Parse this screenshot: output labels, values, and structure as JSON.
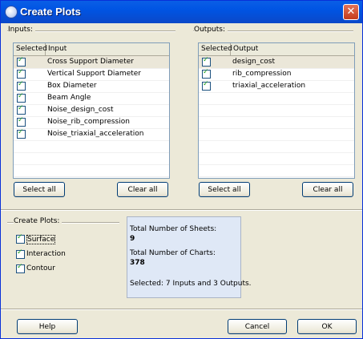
{
  "window": {
    "title": "Create Plots",
    "close_label": "✕"
  },
  "inputs": {
    "group_label": "Inputs:",
    "columns": [
      "Selected",
      "Input"
    ],
    "rows": [
      {
        "label": "Cross Support Diameter",
        "checked": true
      },
      {
        "label": "Vertical Support Diameter",
        "checked": true
      },
      {
        "label": "Box Diameter",
        "checked": true
      },
      {
        "label": "Beam Angle",
        "checked": true
      },
      {
        "label": "Noise_design_cost",
        "checked": true
      },
      {
        "label": "Noise_rib_compression",
        "checked": true
      },
      {
        "label": "Noise_triaxial_acceleration",
        "checked": true
      }
    ],
    "select_all_label": "Select all",
    "clear_all_label": "Clear all"
  },
  "outputs": {
    "group_label": "Outputs:",
    "columns": [
      "Selected",
      "Output"
    ],
    "rows": [
      {
        "label": "design_cost",
        "checked": true
      },
      {
        "label": "rib_compression",
        "checked": true
      },
      {
        "label": "triaxial_acceleration",
        "checked": true
      }
    ],
    "select_all_label": "Select all",
    "clear_all_label": "Clear all"
  },
  "create_plots": {
    "group_label": "Create Plots:",
    "options": [
      {
        "label": "Surface",
        "checked": true
      },
      {
        "label": "Interaction",
        "checked": true
      },
      {
        "label": "Contour",
        "checked": true
      }
    ]
  },
  "summary": {
    "sheets_label": "Total Number of Sheets:",
    "sheets_value": "9",
    "charts_label": "Total Number of Charts:",
    "charts_value": "378",
    "selected_text": "Selected: 7 Inputs and 3 Outputs."
  },
  "footer": {
    "help_label": "Help",
    "cancel_label": "Cancel",
    "ok_label": "OK"
  },
  "colors": {
    "titlebar": "#0054e3",
    "window_bg": "#ece9d8",
    "summary_bg": "#dfe8f6",
    "check": "#21a121"
  }
}
